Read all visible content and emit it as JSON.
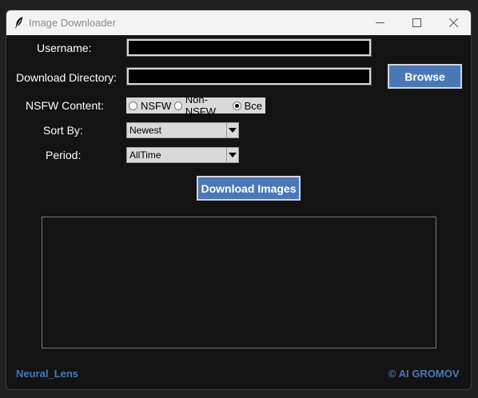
{
  "window": {
    "title": "Image Downloader"
  },
  "form": {
    "username_label": "Username:",
    "username_value": "",
    "directory_label": "Download Directory:",
    "directory_value": "",
    "browse_label": "Browse",
    "nsfw_label": "NSFW Content:",
    "nsfw_options": [
      "NSFW",
      "Non-NSFW",
      "Все"
    ],
    "nsfw_selected": "Все",
    "sort_label": "Sort By:",
    "sort_value": "Newest",
    "period_label": "Period:",
    "period_value": "AllTime",
    "download_label": "Download Images"
  },
  "log": {
    "text": ""
  },
  "footer": {
    "left": "Neural_Lens",
    "right": "© AI GROMOV"
  },
  "colors": {
    "accent": "#4a78b6",
    "background": "#131313"
  }
}
